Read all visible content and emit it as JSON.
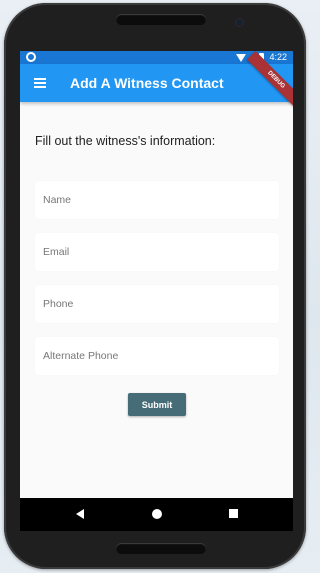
{
  "status_bar": {
    "time": "4:22",
    "icons": [
      "status-circle-icon",
      "wifi-icon",
      "signal-icon",
      "battery-icon"
    ]
  },
  "app_bar": {
    "title": "Add A Witness Contact",
    "menu_icon": "menu-icon",
    "background": "#2196f3",
    "banner": "DEBUG",
    "banner_color": "#a83236"
  },
  "form": {
    "prompt": "Fill out the witness's information:",
    "fields": {
      "name": {
        "placeholder": "Name",
        "value": ""
      },
      "email": {
        "placeholder": "Email",
        "value": ""
      },
      "phone": {
        "placeholder": "Phone",
        "value": ""
      },
      "alt_phone": {
        "placeholder": "Alternate Phone",
        "value": ""
      }
    },
    "submit_label": "Submit",
    "submit_color": "#456c77"
  },
  "nav_bar": {
    "icons": [
      "back-icon",
      "home-icon",
      "recents-icon"
    ]
  }
}
